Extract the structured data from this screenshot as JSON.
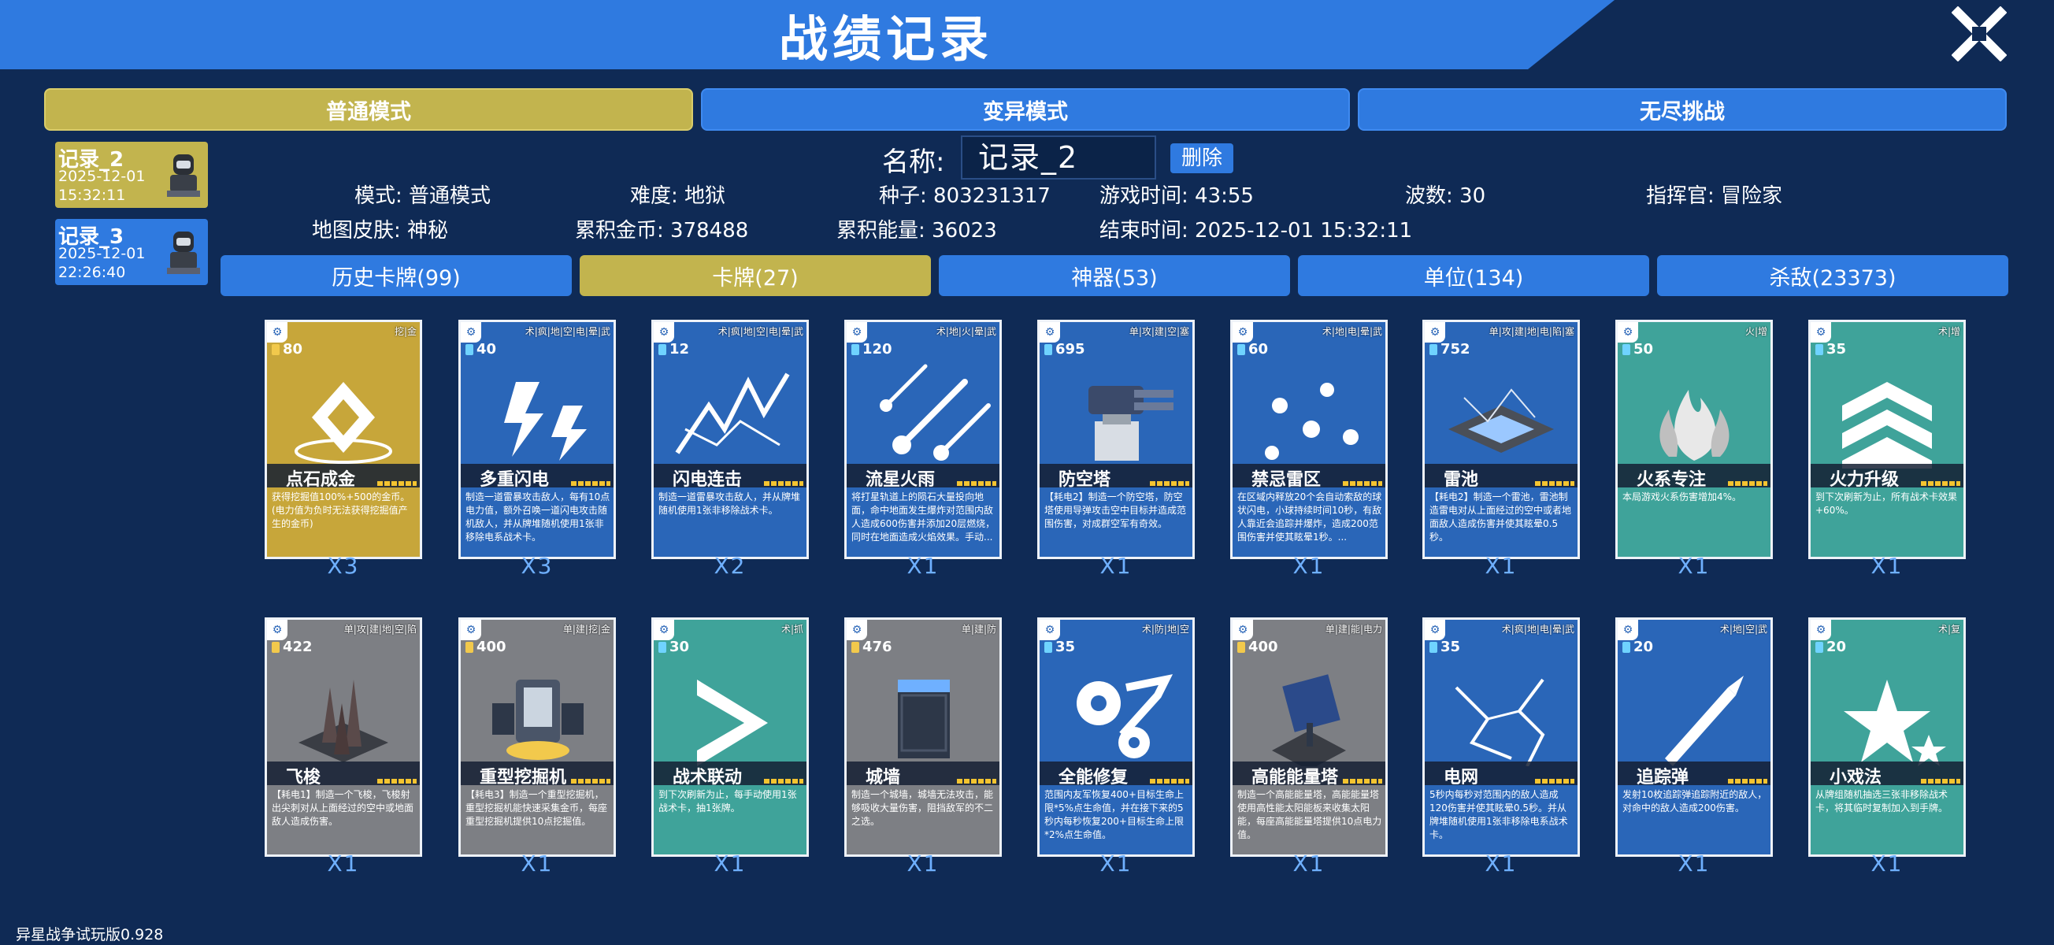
{
  "title": "战绩记录",
  "mode_tabs": [
    {
      "label": "普通模式",
      "active": true
    },
    {
      "label": "变异模式",
      "active": false
    },
    {
      "label": "无尽挑战",
      "active": false
    }
  ],
  "records": [
    {
      "name": "记录_2",
      "date": "2025-12-01",
      "time": "15:32:11",
      "active": true
    },
    {
      "name": "记录_3",
      "date": "2025-12-01",
      "time": "22:26:40",
      "active": false
    }
  ],
  "record_info": {
    "name_label": "名称:",
    "name_value": "记录_2",
    "delete_label": "删除",
    "mode": "模式: 普通模式",
    "difficulty": "难度: 地狱",
    "seed": "种子: 803231317",
    "game_time": "游戏时间: 43:55",
    "waves": "波数: 30",
    "commander": "指挥官: 冒险家",
    "map_skin": "地图皮肤: 神秘",
    "total_gold": "累积金币: 378488",
    "total_energy": "累积能量: 36023",
    "end_time": "结束时间: 2025-12-01 15:32:11"
  },
  "category_tabs": [
    {
      "label": "历史卡牌(99)",
      "active": false
    },
    {
      "label": "卡牌(27)",
      "active": true
    },
    {
      "label": "神器(53)",
      "active": false
    },
    {
      "label": "单位(134)",
      "active": false
    },
    {
      "label": "杀敌(23373)",
      "active": false
    }
  ],
  "cards": [
    {
      "name": "点石成金",
      "cost": "80",
      "tags": "挖|金",
      "count": "X3",
      "color": "gold",
      "art": "diamond",
      "desc": "获得挖掘值100%+500的金币。(电力值为负时无法获得挖掘值产生的金币)"
    },
    {
      "name": "多重闪电",
      "cost": "40",
      "tags": "术|疯|地|空|电|晕|武",
      "count": "X3",
      "color": "blue",
      "art": "bolts",
      "desc": "制造一道雷暴攻击敌人，每有10点电力值，额外召唤一道闪电攻击随机敌人，并从牌堆随机使用1张非移除电系战术卡。"
    },
    {
      "name": "闪电连击",
      "cost": "12",
      "tags": "术|疯|地|空|电|晕|武",
      "count": "X2",
      "color": "blue",
      "art": "chain",
      "desc": "制造一道雷暴攻击敌人，并从牌堆随机使用1张非移除战术卡。"
    },
    {
      "name": "流星火雨",
      "cost": "120",
      "tags": "术|地|火|晕|武",
      "count": "X1",
      "color": "blue",
      "art": "meteor",
      "desc": "将打星轨道上的陨石大量投向地面，命中地面发生爆炸对范围内敌人造成600伤害并添加20层燃烧，同时在地面造成火焰效果。手动..."
    },
    {
      "name": "防空塔",
      "cost": "695",
      "tags": "单|攻|建|空|塞",
      "count": "X1",
      "color": "blue",
      "art": "turret",
      "desc": "【耗电2】制造一个防空塔，防空塔使用导弹攻击空中目标并造成范围伤害，对成群空军有奇效。"
    },
    {
      "name": "禁忌雷区",
      "cost": "60",
      "tags": "术|地|电|晕|武",
      "count": "X1",
      "color": "blue",
      "art": "orbs",
      "desc": "在区域内释放20个会自动索敌的球状闪电，小球持续时间10秒，有敌人靠近会追踪并爆炸，造成200范围伤害并使其眩晕1秒。..."
    },
    {
      "name": "雷池",
      "cost": "752",
      "tags": "单|攻|建|地|电|陷|塞",
      "count": "X1",
      "color": "blue",
      "art": "pool",
      "desc": "【耗电2】制造一个雷池，雷池制造雷电对从上面经过的空中或者地面敌人造成伤害并使其眩晕0.5秒。"
    },
    {
      "name": "火系专注",
      "cost": "50",
      "tags": "火|增",
      "count": "X1",
      "color": "teal",
      "art": "flame",
      "desc": "本局游戏火系伤害增加4%。"
    },
    {
      "name": "火力升级",
      "cost": "35",
      "tags": "术|增",
      "count": "X1",
      "color": "teal",
      "art": "chevrons",
      "desc": "到下次刷新为止，所有战术卡效果+60%。"
    },
    {
      "name": "飞梭",
      "cost": "422",
      "tags": "单|攻|建|地|空|陷",
      "count": "X1",
      "color": "gray",
      "art": "spikes",
      "desc": "【耗电1】制造一个飞梭，飞梭射出尖刺对从上面经过的空中或地面敌人造成伤害。"
    },
    {
      "name": "重型挖掘机",
      "cost": "400",
      "tags": "单|建|挖|金",
      "count": "X1",
      "color": "gray",
      "art": "drill",
      "desc": "【耗电3】制造一个重型挖掘机，重型挖掘机能快速采集金币，每座重型挖掘机提供10点挖掘值。"
    },
    {
      "name": "战术联动",
      "cost": "30",
      "tags": "术|抓",
      "count": "X1",
      "color": "teal",
      "art": "arrow",
      "desc": "到下次刷新为止，每手动使用1张战术卡，抽1张牌。"
    },
    {
      "name": "城墙",
      "cost": "476",
      "tags": "单|建|防",
      "count": "X1",
      "color": "gray",
      "art": "wall",
      "desc": "制造一个城墙，城墙无法攻击，能够吸收大量伤害，阻挡敌军的不二之选。"
    },
    {
      "name": "全能修复",
      "cost": "35",
      "tags": "术|防|地|空",
      "count": "X1",
      "color": "blue",
      "art": "gears",
      "desc": "范围内友军恢复400+目标生命上限*5%点生命值，并在接下来的5秒内每秒恢复200+目标生命上限*2%点生命值。"
    },
    {
      "name": "高能能量塔",
      "cost": "400",
      "tags": "单|建|能|电力",
      "count": "X1",
      "color": "gray",
      "art": "solar",
      "desc": "制造一个高能能量塔，高能能量塔使用高性能太阳能板来收集太阳能，每座高能能量塔提供10点电力值。"
    },
    {
      "name": "电网",
      "cost": "35",
      "tags": "术|疯|地|电|晕|武",
      "count": "X1",
      "color": "blue",
      "art": "net",
      "desc": "5秒内每秒对范围内的敌人造成120伤害并使其眩晕0.5秒。并从牌堆随机使用1张非移除电系战术卡。"
    },
    {
      "name": "追踪弹",
      "cost": "20",
      "tags": "术|地|空|武",
      "count": "X1",
      "color": "blue",
      "art": "missile",
      "desc": "发射10枚追踪弹追踪附近的敌人，对命中的敌人造成200伤害。"
    },
    {
      "name": "小戏法",
      "cost": "20",
      "tags": "术|复",
      "count": "X1",
      "color": "teal",
      "art": "stars",
      "desc": "从牌组随机抽选三张非移除战术卡，将其临时复制加入到手牌。"
    }
  ],
  "version": "异星战争试玩版0.928"
}
